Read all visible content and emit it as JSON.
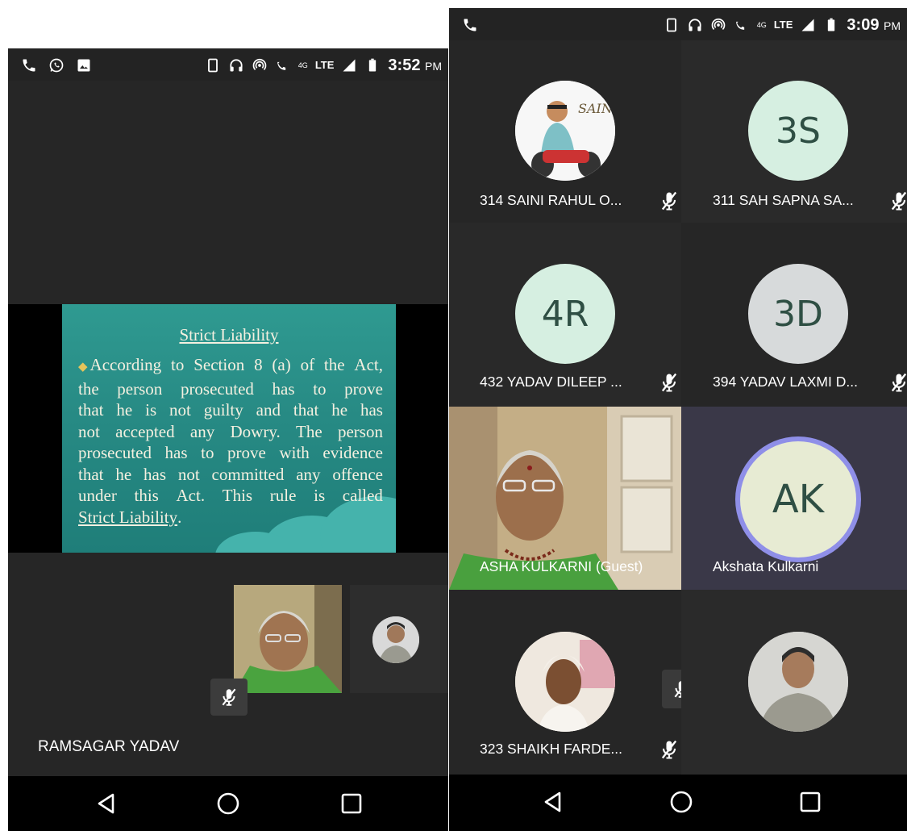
{
  "left_screen": {
    "status_bar": {
      "time": "3:52",
      "ampm": "PM",
      "net_badge": "4G",
      "lte": "LTE"
    },
    "slide": {
      "title": "Strict Liability",
      "lines": [
        [
          "According",
          "to",
          "Section",
          "8",
          "(a)",
          "of",
          "the",
          "Act,"
        ],
        [
          "the",
          "person",
          "prosecuted",
          "has",
          "to",
          "prove"
        ],
        [
          "that",
          "he",
          "is",
          "not",
          "guilty",
          "and",
          "that",
          "he",
          "has"
        ],
        [
          "not",
          "accepted",
          "any",
          "Dowry.",
          "The",
          "person"
        ],
        [
          "prosecuted",
          "has",
          "to",
          "prove",
          "with",
          "evidence"
        ],
        [
          "that",
          "he",
          "has",
          "not",
          "committed",
          "any",
          "offence"
        ],
        [
          "under",
          "this",
          "Act.",
          "This",
          "rule",
          "is",
          "called"
        ]
      ],
      "final_term": "Strict Liability",
      "final_punct": "."
    },
    "presenter_name": "RAMSAGAR YADAV"
  },
  "right_screen": {
    "status_bar": {
      "time": "3:09",
      "ampm": "PM",
      "net_badge": "4G",
      "lte": "LTE"
    },
    "participants": [
      {
        "name": "314 SAINI RAHUL O...",
        "avatar": "photo-saini-logo",
        "muted": true
      },
      {
        "name": "311 SAH SAPNA SA...",
        "initials": "3S",
        "muted": true
      },
      {
        "name": "432 YADAV DILEEP ...",
        "initials": "4R",
        "muted": true
      },
      {
        "name": "394 YADAV LAXMI D...",
        "initials": "3D",
        "muted": true
      },
      {
        "name": "ASHA  KULKARNI (Guest)",
        "avatar": "live-video",
        "muted": false
      },
      {
        "name": "Akshata Kulkarni",
        "initials": "AK",
        "muted": false,
        "active_speaker": true
      },
      {
        "name": "323 SHAIKH FARDE...",
        "avatar": "photo-turban",
        "muted": true
      },
      {
        "name": "",
        "avatar": "photo-man",
        "muted": false
      }
    ]
  },
  "colors": {
    "tile_bg": "#262626",
    "slide_teal": "#278a84",
    "initials_green": "#d6efe1",
    "initials_gray": "#d7dadb",
    "active_ring": "#8f8fe8",
    "ak_tile_bg": "#3a3848"
  }
}
